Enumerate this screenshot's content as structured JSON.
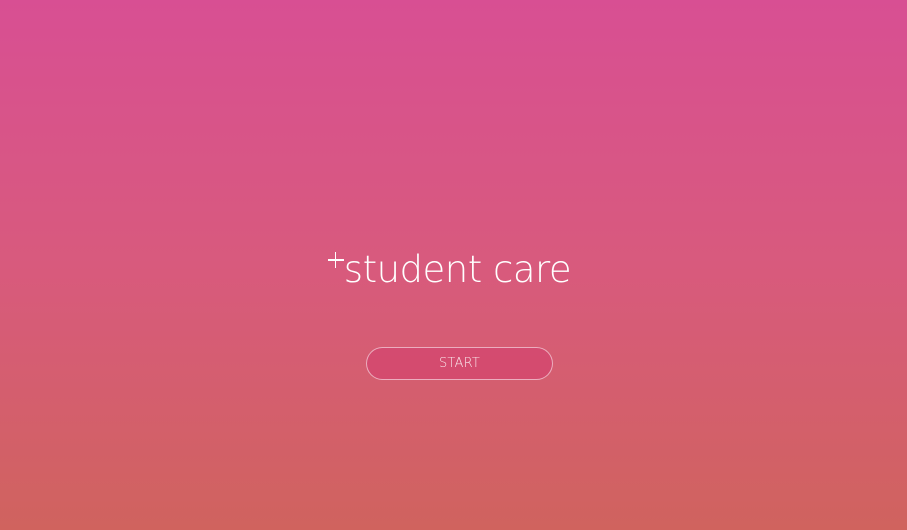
{
  "app": {
    "logo_symbol": "+",
    "logo_text": "student care",
    "logo_icon": "plus-icon"
  },
  "actions": {
    "start_label": "START"
  },
  "colors": {
    "gradient_top": "#d84f93",
    "gradient_middle": "#d85a7d",
    "gradient_bottom": "#d0635e",
    "text": "#ffffff"
  }
}
